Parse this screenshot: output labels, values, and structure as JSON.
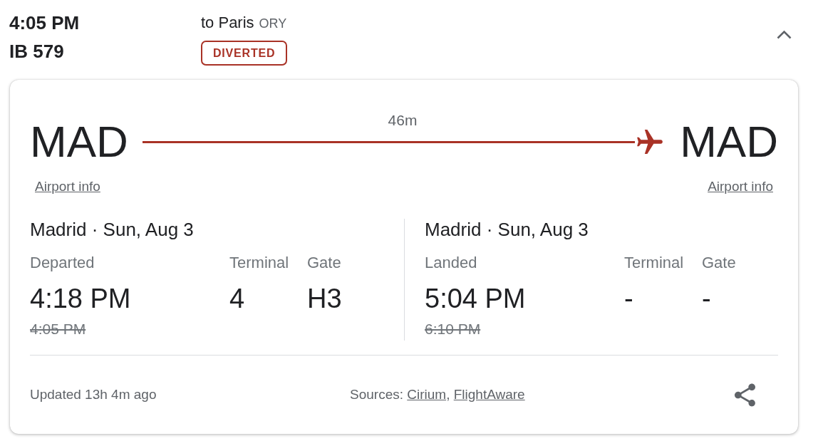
{
  "flight": {
    "departure_time": "4:05 PM",
    "flight_number": "IB 579",
    "destination": "to Paris",
    "destination_code": "ORY",
    "status": "DIVERTED",
    "expanded": true
  },
  "details": {
    "route": {
      "origin": {
        "code": "MAD",
        "link": "Airport info"
      },
      "duration": "46m",
      "destination": {
        "code": "MAD",
        "link": "Airport info"
      }
    },
    "legs": [
      {
        "place_date": "Madrid · Sun, Aug 3",
        "status_label": "Departed",
        "terminal_label": "Terminal",
        "gate_label": "Gate",
        "actual_time": "4:18 PM",
        "terminal": "4",
        "gate": "H3",
        "scheduled_time": "4:05 PM"
      },
      {
        "place_date": "Madrid · Sun, Aug 3",
        "status_label": "Landed",
        "terminal_label": "Terminal",
        "gate_label": "Gate",
        "actual_time": "5:04 PM",
        "terminal": "-",
        "gate": "-",
        "scheduled_time": "6:10 PM"
      }
    ],
    "footer": {
      "updated": "Updated 13h 4m ago",
      "sources_label": "Sources:",
      "sources": [
        {
          "name": "Cirium"
        },
        {
          "name": "FlightAware"
        }
      ],
      "source_separator": ","
    }
  }
}
